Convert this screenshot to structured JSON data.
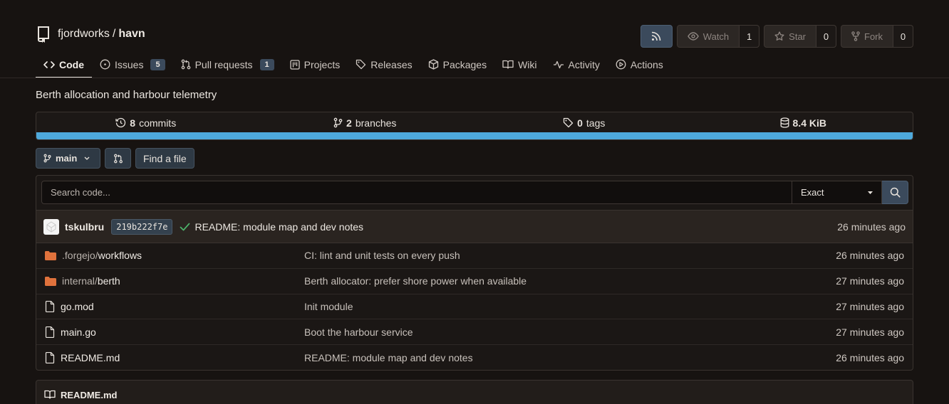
{
  "repo": {
    "owner": "fjordworks",
    "separator": "/",
    "name": "havn",
    "description": "Berth allocation and harbour telemetry"
  },
  "actions": {
    "watch": {
      "label": "Watch",
      "count": "1"
    },
    "star": {
      "label": "Star",
      "count": "0"
    },
    "fork": {
      "label": "Fork",
      "count": "0"
    }
  },
  "tabs": [
    {
      "label": "Code",
      "icon": "code-icon",
      "active": true
    },
    {
      "label": "Issues",
      "icon": "issue-icon",
      "badge": "5"
    },
    {
      "label": "Pull requests",
      "icon": "pull-request-icon",
      "badge": "1"
    },
    {
      "label": "Projects",
      "icon": "project-icon"
    },
    {
      "label": "Releases",
      "icon": "tag-icon"
    },
    {
      "label": "Packages",
      "icon": "package-icon"
    },
    {
      "label": "Wiki",
      "icon": "book-icon"
    },
    {
      "label": "Activity",
      "icon": "pulse-icon"
    },
    {
      "label": "Actions",
      "icon": "play-icon"
    }
  ],
  "stats": {
    "commits": {
      "count": "8",
      "label": "commits"
    },
    "branches": {
      "count": "2",
      "label": "branches"
    },
    "tags": {
      "count": "0",
      "label": "tags"
    },
    "size": {
      "value": "8.4 KiB"
    },
    "language_bar_color": "#4ea9dc"
  },
  "toolbar": {
    "branch": "main",
    "find_file": "Find a file"
  },
  "search": {
    "placeholder": "Search code...",
    "mode": "Exact"
  },
  "latest_commit": {
    "author": "tskulbru",
    "sha": "219b222f7e",
    "status": "success",
    "message": "README: module map and dev notes",
    "time": "26 minutes ago"
  },
  "files": [
    {
      "type": "dir",
      "prefix": ".forgejo/",
      "name": "workflows",
      "message": "CI: lint and unit tests on every push",
      "time": "26 minutes ago"
    },
    {
      "type": "dir",
      "prefix": "internal/",
      "name": "berth",
      "message": "Berth allocator: prefer shore power when available",
      "time": "27 minutes ago"
    },
    {
      "type": "file",
      "prefix": "",
      "name": "go.mod",
      "message": "Init module",
      "time": "27 minutes ago"
    },
    {
      "type": "file",
      "prefix": "",
      "name": "main.go",
      "message": "Boot the harbour service",
      "time": "27 minutes ago"
    },
    {
      "type": "file",
      "prefix": "",
      "name": "README.md",
      "message": "README: module map and dev notes",
      "time": "26 minutes ago"
    }
  ],
  "readme": {
    "title": "README.md"
  },
  "colors": {
    "background": "#171311",
    "accent": "#3b4a5c",
    "folder": "#e0723c",
    "success": "#4cb36a"
  }
}
